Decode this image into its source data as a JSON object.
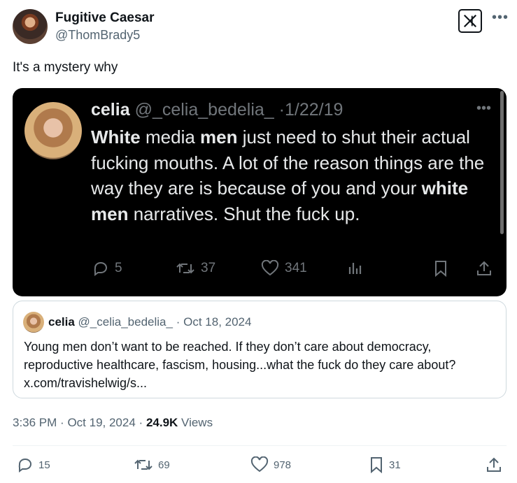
{
  "author": {
    "name": "Fugitive Caesar",
    "handle": "@ThomBrady5"
  },
  "tweet": {
    "text": "It's a mystery why"
  },
  "screenshot": {
    "name": "celia",
    "handle": "@_celia_bedelia_",
    "date_sep": "·",
    "date": "1/22/19",
    "body_parts": [
      {
        "t": "White",
        "b": true
      },
      {
        "t": " media ",
        "b": false
      },
      {
        "t": "men",
        "b": true
      },
      {
        "t": " just need to shut their actual fucking mouths. A lot of the reason things are the way they are is because of you and your ",
        "b": false
      },
      {
        "t": "white men",
        "b": true
      },
      {
        "t": " narratives. Shut the fuck up.",
        "b": false
      }
    ],
    "replies": "5",
    "reposts": "37",
    "likes": "341"
  },
  "quote": {
    "name": "celia",
    "handle": "@_celia_bedelia_",
    "sep": "·",
    "date": "Oct 18, 2024",
    "text": "Young men don’t want to be reached. If they don’t care about democracy, reproductive healthcare, fascism, housing...what the fuck do they care about?",
    "link": "x.com/travishelwig/s..."
  },
  "meta": {
    "time": "3:36 PM",
    "sep": "·",
    "date": "Oct 19, 2024",
    "sep2": "·",
    "views_count": "24.9K",
    "views_label": "Views"
  },
  "actions": {
    "replies": "15",
    "reposts": "69",
    "likes": "978",
    "bookmarks": "31"
  },
  "icons": [
    "x-logo-icon",
    "more-icon",
    "reply-icon",
    "repost-icon",
    "like-icon",
    "analytics-icon",
    "bookmark-icon",
    "share-icon"
  ]
}
